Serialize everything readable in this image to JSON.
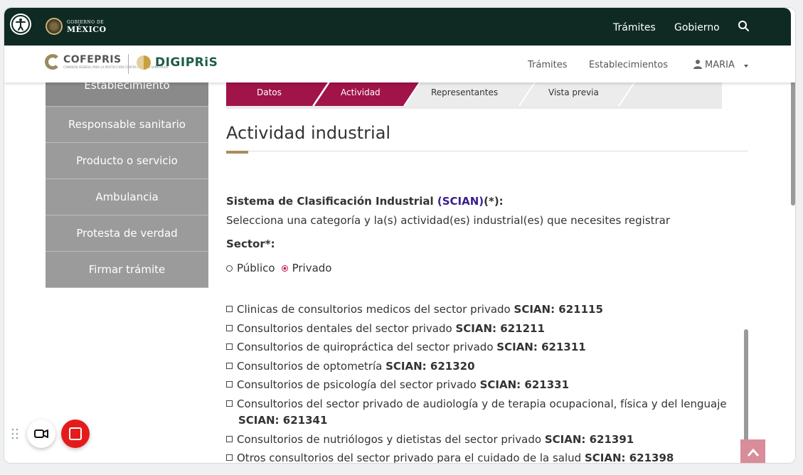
{
  "gov_header": {
    "logo_line1": "GOBIERNO DE",
    "logo_line2": "MÉXICO",
    "nav": [
      "Trámites",
      "Gobierno"
    ]
  },
  "app_header": {
    "brand1": "COFEPRIS",
    "brand1_sub": "COMISIÓN FEDERAL PARA LA PROTECCIÓN CONTRA RIESGOS SANITARIOS",
    "brand2": "DIGIPRiS",
    "nav": [
      "Trámites",
      "Establecimientos"
    ],
    "user": "MARIA"
  },
  "sidebar": {
    "items": [
      {
        "label": "Establecimiento"
      },
      {
        "label": "Responsable sanitario"
      },
      {
        "label": "Producto o servicio"
      },
      {
        "label": "Ambulancia"
      },
      {
        "label": "Protesta de verdad"
      },
      {
        "label": "Firmar trámite"
      }
    ]
  },
  "stepper": {
    "steps": [
      {
        "label": "Datos",
        "state": "done"
      },
      {
        "label": "Actividad",
        "state": "active"
      },
      {
        "label": "Representantes",
        "state": "pending"
      },
      {
        "label": "Vista previa",
        "state": "pending"
      }
    ]
  },
  "main": {
    "title": "Actividad industrial",
    "scian_prefix": "Sistema de Clasificación Industrial ",
    "scian_link": "(SCIAN)",
    "scian_suffix": "(*):",
    "instruction": "Selecciona una categoría y la(s) actividad(es) industrial(es) que necesites registrar",
    "sector_label": "Sector*:",
    "sector_options": [
      {
        "label": "Público",
        "selected": false
      },
      {
        "label": "Privado",
        "selected": true
      }
    ],
    "activities": [
      {
        "text": "Clinicas de consultorios medicos del sector privado",
        "code": "SCIAN: 621115"
      },
      {
        "text": "Consultorios dentales del sector privado",
        "code": "SCIAN: 621211"
      },
      {
        "text": "Consultorios de quiropráctica del sector privado",
        "code": "SCIAN: 621311"
      },
      {
        "text": "Consultorios de optometría",
        "code": "SCIAN: 621320"
      },
      {
        "text": "Consultorios de psicología del sector privado",
        "code": "SCIAN: 621331"
      },
      {
        "text": "Consultorios del sector privado de audiología y de terapia ocupacional, física y del lenguaje",
        "code": "SCIAN: 621341"
      },
      {
        "text": "Consultorios de nutriólogos y dietistas del sector privado",
        "code": "SCIAN: 621391"
      },
      {
        "text": "Otros consultorios del sector privado para el cuidado de la salud",
        "code": "SCIAN: 621398"
      }
    ]
  },
  "colors": {
    "gov_bar": "#0f2a22",
    "step_active": "#a0144a",
    "accent_gold": "#a98d5b",
    "digipris_green": "#1e5c4a",
    "scian_link": "#3a1e8c",
    "radio_selected": "#c2185b"
  },
  "icons": [
    "accessibility-icon",
    "search-icon",
    "user-icon",
    "drag-handle-icon",
    "video-camera-icon",
    "stop-record-icon",
    "chevron-up-icon"
  ]
}
